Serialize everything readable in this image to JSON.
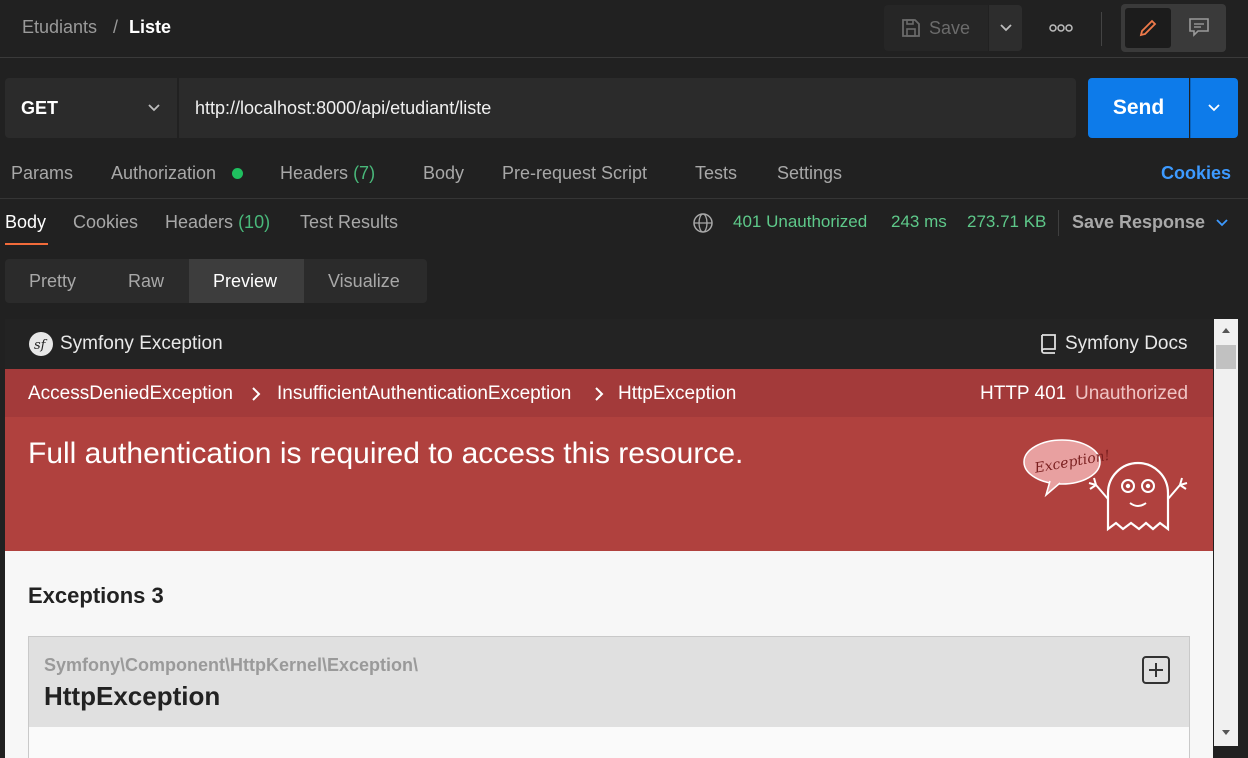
{
  "breadcrumb": {
    "parent": "Etudiants",
    "separator": "/",
    "current": "Liste"
  },
  "toolbar": {
    "save_label": "Save",
    "more": "ooo"
  },
  "request": {
    "method": "GET",
    "url": "http://localhost:8000/api/etudiant/liste",
    "send_label": "Send"
  },
  "request_tabs": {
    "params": "Params",
    "authorization": "Authorization",
    "headers": "Headers",
    "headers_count": "(7)",
    "body": "Body",
    "prerequest": "Pre-request Script",
    "tests": "Tests",
    "settings": "Settings",
    "cookies": "Cookies"
  },
  "response_tabs": {
    "body": "Body",
    "cookies": "Cookies",
    "headers": "Headers",
    "headers_count": "(10)",
    "test_results": "Test Results"
  },
  "response_status": {
    "status": "401 Unauthorized",
    "time": "243 ms",
    "size": "273.71 KB",
    "save_response": "Save Response"
  },
  "view_tabs": {
    "pretty": "Pretty",
    "raw": "Raw",
    "preview": "Preview",
    "visualize": "Visualize"
  },
  "preview": {
    "brand": "Symfony Exception",
    "docs": "Symfony Docs",
    "chain": [
      "AccessDeniedException",
      "InsufficientAuthenticationException",
      "HttpException"
    ],
    "http_code": "HTTP 401",
    "http_text": "Unauthorized",
    "message": "Full authentication is required to access this resource.",
    "ghost_label": "Exception!",
    "exceptions_title": "Exceptions 3",
    "exception_namespace": "Symfony\\Component\\HttpKernel\\Exception\\",
    "exception_class": "HttpException"
  },
  "colors": {
    "accent_blue": "#0d7bea",
    "status_green": "#49b87a",
    "error_red": "#b0413e",
    "link_blue": "#3d9aff"
  }
}
